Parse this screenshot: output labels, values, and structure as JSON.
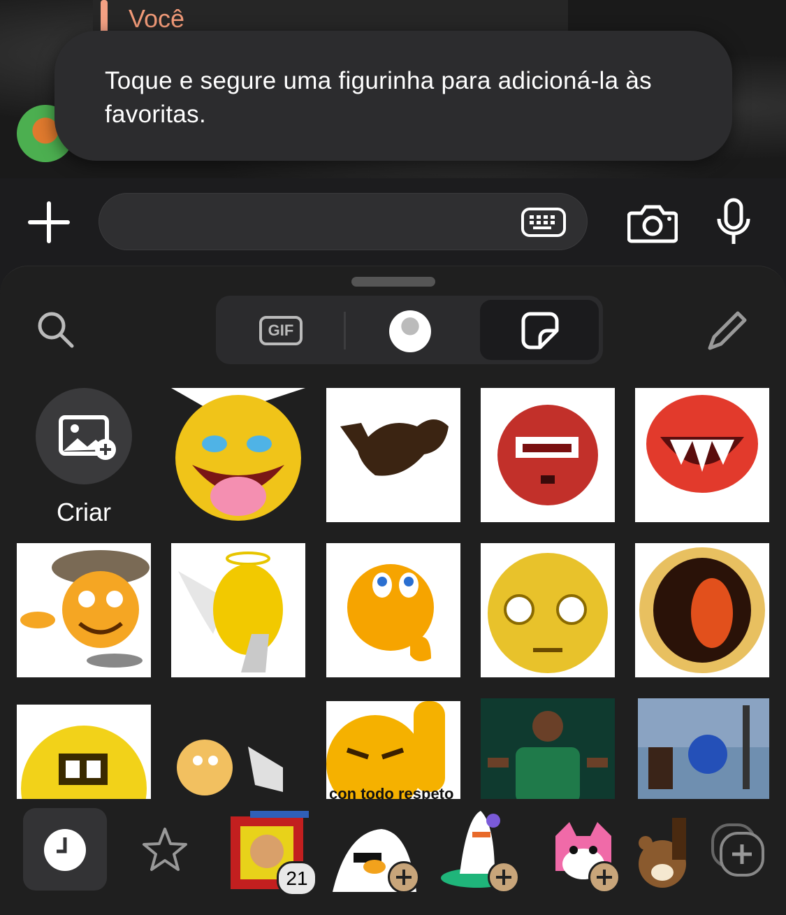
{
  "chat": {
    "reply_name": "Você"
  },
  "toast": {
    "message": "Toque e segure uma figurinha para adicioná-la às favoritas."
  },
  "composer": {
    "placeholder": ""
  },
  "panel": {
    "tabs": [
      "GIF",
      "avatar",
      "stickers"
    ],
    "active_tab": "stickers",
    "gif_label": "GIF",
    "create_label": "Criar"
  },
  "stickers": {
    "last_tile_caption": "con todo respeto"
  },
  "tray": {
    "pack_count": "21"
  },
  "colors": {
    "reply_accent": "#f19a78",
    "panel_bg": "#1f1f1f",
    "toast_bg": "#2c2c2e"
  },
  "icons": [
    "plus-icon",
    "keyboard-icon",
    "camera-icon",
    "microphone-icon",
    "search-icon",
    "gif-icon",
    "avatar-icon",
    "sticker-icon",
    "pencil-icon",
    "add-image-icon",
    "clock-icon",
    "star-icon",
    "add-pack-icon"
  ]
}
